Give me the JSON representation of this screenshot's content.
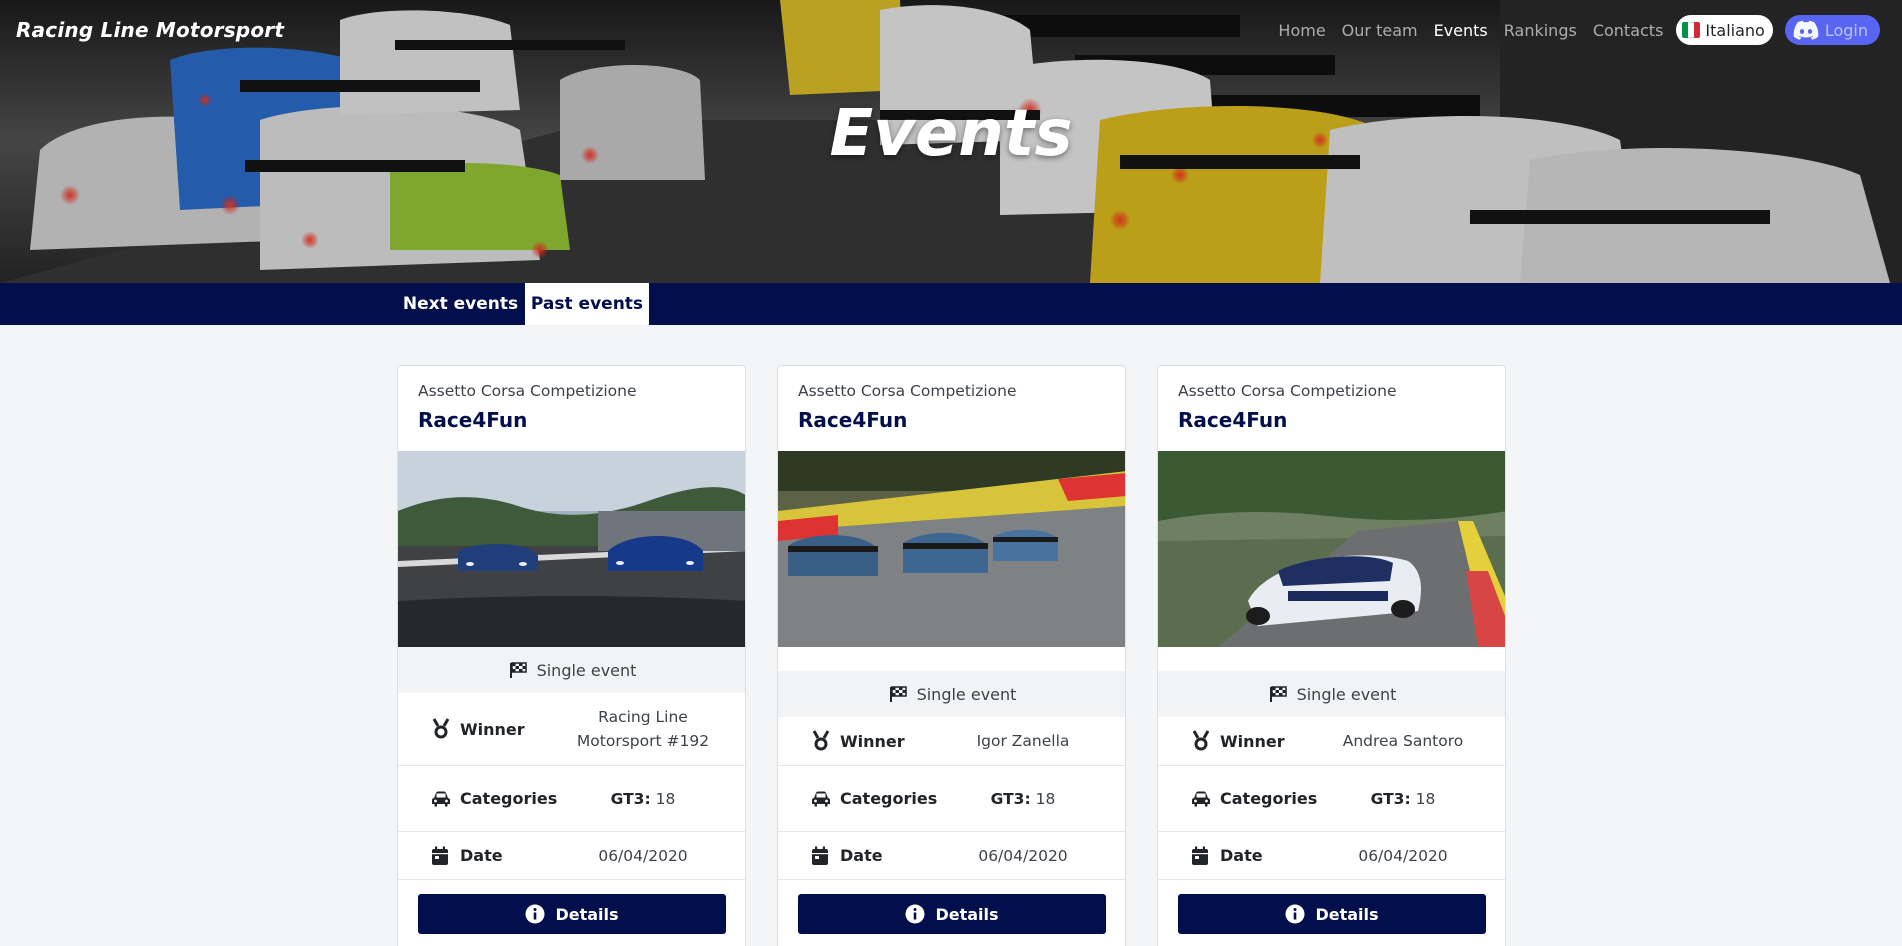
{
  "brand": "Racing Line Motorsport",
  "nav": {
    "items": [
      "Home",
      "Our team",
      "Events",
      "Rankings",
      "Contacts"
    ],
    "active": "Events",
    "language": "Italiano",
    "login": "Login"
  },
  "hero": {
    "title": "Events"
  },
  "tabs": {
    "next": "Next events",
    "past": "Past events",
    "selected": "past"
  },
  "labels": {
    "winner": "Winner",
    "categories": "Categories",
    "date": "Date",
    "details": "Details"
  },
  "events": [
    {
      "game": "Assetto Corsa Competizione",
      "title": "Race4Fun",
      "type": "Single event",
      "winner": "Racing Line Motorsport #192",
      "category_name": "GT3:",
      "category_count": "18",
      "date": "06/04/2020"
    },
    {
      "game": "Assetto Corsa Competizione",
      "title": "Race4Fun",
      "type": "Single event",
      "winner": "Igor Zanella",
      "category_name": "GT3:",
      "category_count": "18",
      "date": "06/04/2020"
    },
    {
      "game": "Assetto Corsa Competizione",
      "title": "Race4Fun",
      "type": "Single event",
      "winner": "Andrea Santoro",
      "category_name": "GT3:",
      "category_count": "18",
      "date": "06/04/2020"
    }
  ],
  "colors": {
    "navy": "#020f4c",
    "discord": "#5865f2",
    "background": "#f4f5f7",
    "italy_flag": [
      "#009246",
      "#ffffff",
      "#ce2b37"
    ]
  },
  "icons": {
    "type": "checkered-flag-icon",
    "winner": "medal-icon",
    "categories": "car-icon",
    "date": "calendar-icon",
    "details": "info-icon",
    "login": "discord-icon",
    "language": "italy-flag-icon"
  }
}
